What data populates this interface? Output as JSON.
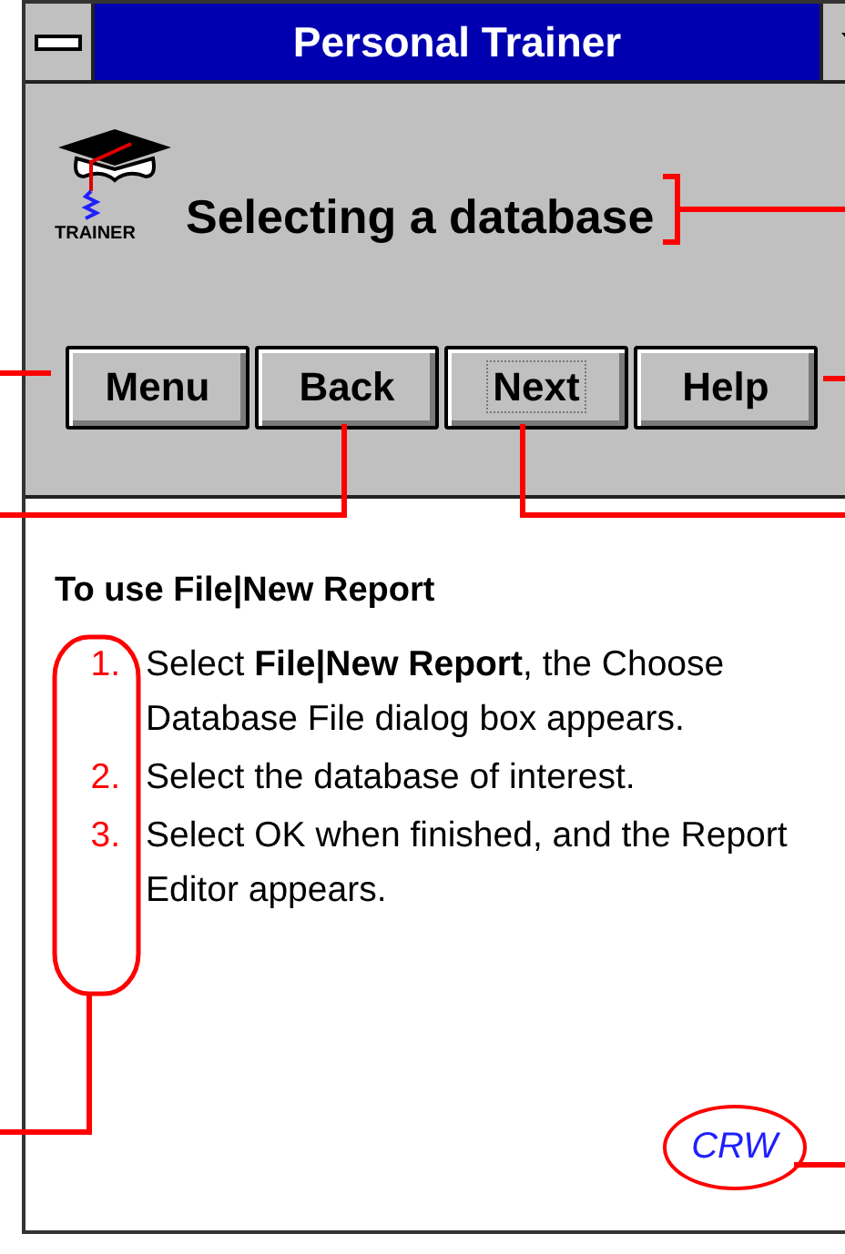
{
  "window": {
    "title": "Personal Trainer"
  },
  "header": {
    "logo_label": "TRAINER",
    "topic": "Selecting a database"
  },
  "buttons": [
    {
      "label": "Menu",
      "focused": false
    },
    {
      "label": "Back",
      "focused": false
    },
    {
      "label": "Next",
      "focused": true
    },
    {
      "label": "Help",
      "focused": false
    }
  ],
  "content": {
    "heading": "To use File|New Report",
    "steps": [
      {
        "number": "1.",
        "text": "Select **File|New Report**, the Choose Database File dialog box appears."
      },
      {
        "number": "2.",
        "text": "Select the database of interest."
      },
      {
        "number": "3.",
        "text": "Select OK when finished, and the Report Editor appears."
      }
    ]
  },
  "footer": {
    "badge": "CRW"
  }
}
